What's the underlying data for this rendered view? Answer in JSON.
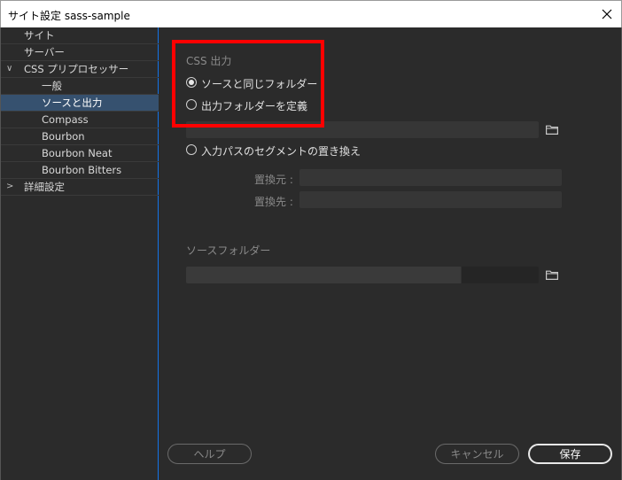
{
  "window": {
    "title": "サイト設定 sass-sample",
    "close_icon": "close-icon"
  },
  "sidebar": {
    "items": [
      {
        "label": "サイト",
        "expander": "",
        "selected": false
      },
      {
        "label": "サーバー",
        "expander": "",
        "selected": false
      },
      {
        "label": "CSS プリプロセッサー",
        "expander": "∨",
        "selected": false
      },
      {
        "label": "一般",
        "expander": "",
        "selected": false
      },
      {
        "label": "ソースと出力",
        "expander": "",
        "selected": true
      },
      {
        "label": "Compass",
        "expander": "",
        "selected": false
      },
      {
        "label": "Bourbon",
        "expander": "",
        "selected": false
      },
      {
        "label": "Bourbon Neat",
        "expander": "",
        "selected": false
      },
      {
        "label": "Bourbon Bitters",
        "expander": "",
        "selected": false
      },
      {
        "label": "詳細設定",
        "expander": ">",
        "selected": false
      }
    ]
  },
  "main": {
    "css_output": {
      "heading": "CSS 出力",
      "options": [
        {
          "label": "ソースと同じフォルダー",
          "checked": true
        },
        {
          "label": "出力フォルダーを定義",
          "checked": false
        },
        {
          "label": "入力パスのセグメントの置き換え",
          "checked": false
        }
      ]
    },
    "replace": {
      "from_label": "置換元 :",
      "to_label": "置換先 :"
    },
    "source_folder": {
      "label": "ソースフォルダー"
    },
    "buttons": {
      "help": "ヘルプ",
      "cancel": "キャンセル",
      "save": "保存"
    }
  },
  "colors": {
    "highlight": "#ff0000",
    "selection": "#36516f",
    "accent": "#1473e6"
  }
}
